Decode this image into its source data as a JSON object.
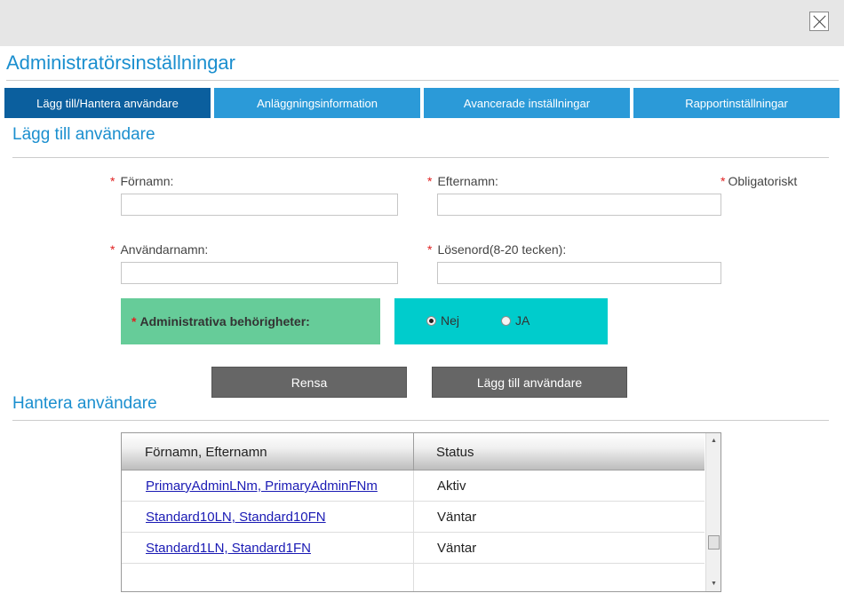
{
  "dialog": {
    "title": "Administratörsinställningar",
    "close_icon": "close-icon"
  },
  "tabs": [
    {
      "label": "Lägg till/Hantera användare",
      "active": true
    },
    {
      "label": "Anläggningsinformation",
      "active": false
    },
    {
      "label": "Avancerade inställningar",
      "active": false
    },
    {
      "label": "Rapportinställningar",
      "active": false
    }
  ],
  "add_user": {
    "section_title": "Lägg till användare",
    "required_marker": "*",
    "required_note": "Obligatoriskt",
    "fields": {
      "first_name": {
        "label": "Förnamn:",
        "value": "",
        "placeholder": ""
      },
      "last_name": {
        "label": "Efternamn:",
        "value": "",
        "placeholder": ""
      },
      "username": {
        "label": "Användarnamn:",
        "value": "",
        "placeholder": ""
      },
      "password": {
        "label": "Lösenord(8-20 tecken):",
        "value": "",
        "placeholder": ""
      }
    },
    "admin_rights": {
      "label": "Administrativa behörigheter:",
      "options": [
        {
          "label": "Nej",
          "checked": true
        },
        {
          "label": "JA",
          "checked": false
        }
      ]
    },
    "buttons": {
      "clear": "Rensa",
      "add": "Lägg till användare"
    }
  },
  "manage_users": {
    "section_title": "Hantera användare",
    "columns": [
      "Förnamn, Efternamn",
      "Status"
    ],
    "rows": [
      {
        "name": "PrimaryAdminLNm, PrimaryAdminFNm",
        "status": "Aktiv"
      },
      {
        "name": "Standard10LN, Standard10FN",
        "status": "Väntar"
      },
      {
        "name": "Standard1LN, Standard1FN",
        "status": "Väntar"
      }
    ]
  },
  "colors": {
    "accent": "#1b8fcf",
    "tab": "#2b9ad8",
    "tab_active": "#0b5f9e",
    "admin_label_bg": "#66cc99",
    "admin_options_bg": "#00cccc",
    "button": "#666666",
    "required": "#e02020",
    "link": "#1a1ab4"
  }
}
